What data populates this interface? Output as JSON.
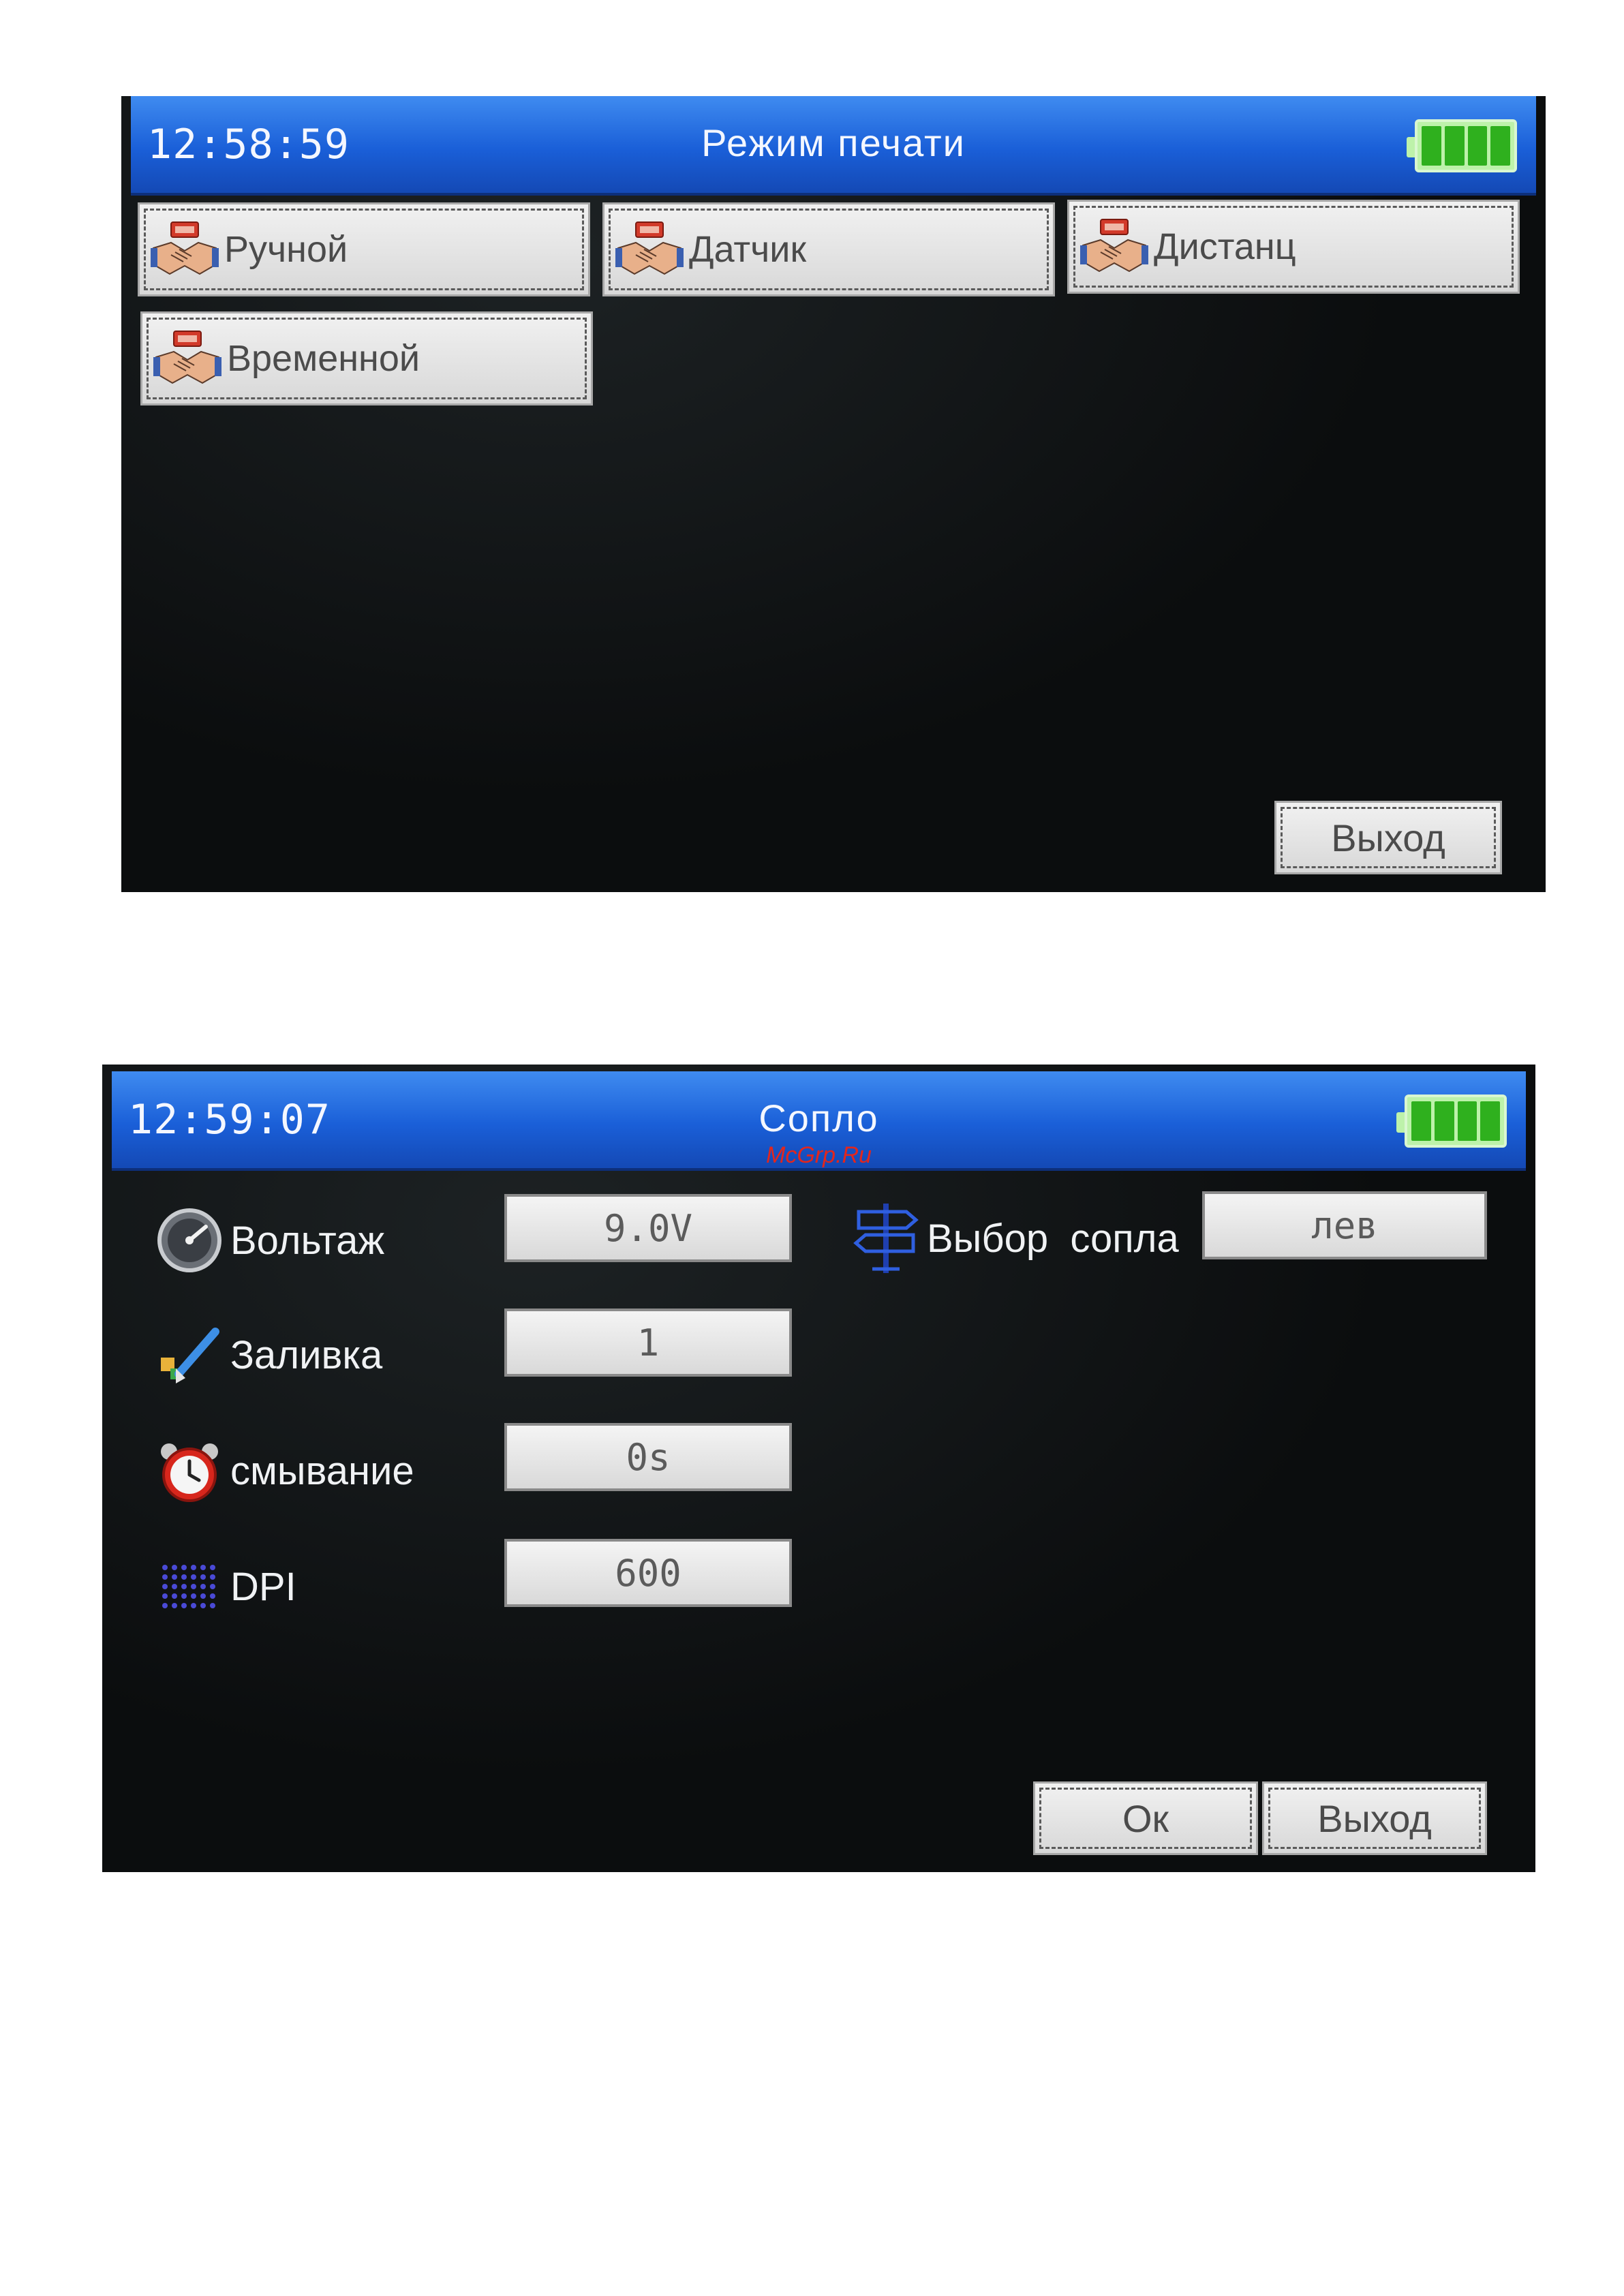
{
  "screen1": {
    "clock": "12:58:59",
    "title": "Режим печати",
    "modes": [
      {
        "label": "Ручной"
      },
      {
        "label": "Датчик"
      },
      {
        "label": "Дистанц"
      },
      {
        "label": "Временной"
      }
    ],
    "exit_label": "Выход",
    "battery_level": 1.0
  },
  "screen2": {
    "clock": "12:59:07",
    "title": "Сопло",
    "watermark": "McGrp.Ru",
    "rows": [
      {
        "label": "Вольтаж",
        "value": "9.0V",
        "icon": "gauge-icon"
      },
      {
        "label": "Заливка",
        "value": "1",
        "icon": "paint-brush-icon"
      },
      {
        "label": "смывание",
        "value": "0s",
        "icon": "alarm-clock-icon"
      },
      {
        "label": "DPI",
        "value": "600",
        "icon": "dot-grid-icon"
      }
    ],
    "nozzle": {
      "label": "Выбор  сопла",
      "value": "лев",
      "icon": "signpost-icon"
    },
    "ok_label": "Ок",
    "exit_label": "Выход",
    "battery_level": 1.0
  },
  "colors": {
    "titlebar": "#1a5fd8",
    "battery": "#2fb01e",
    "button": "#d8d8d8",
    "screen": "#0b0d0e",
    "watermark": "#e3261d"
  }
}
